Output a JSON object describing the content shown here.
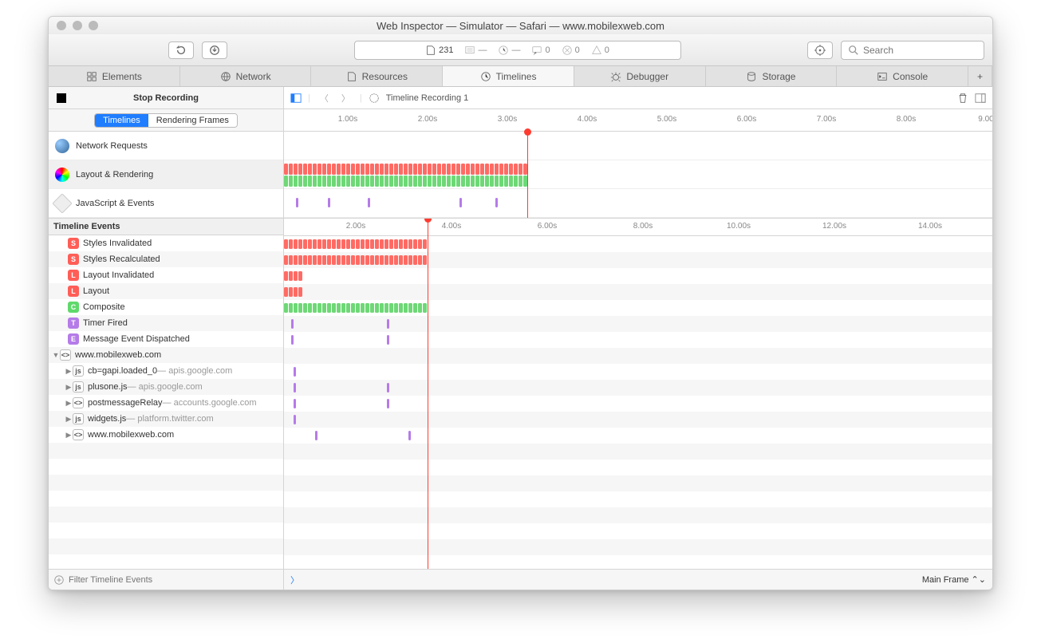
{
  "window_title": "Web Inspector — Simulator — Safari — www.mobilexweb.com",
  "addressbar": {
    "count": "231",
    "msg": "0",
    "err": "0",
    "warn": "0"
  },
  "search": {
    "placeholder": "Search"
  },
  "tabs": [
    "Elements",
    "Network",
    "Resources",
    "Timelines",
    "Debugger",
    "Storage",
    "Console"
  ],
  "active_tab": "Timelines",
  "stop_label": "Stop Recording",
  "segments": {
    "timelines": "Timelines",
    "frames": "Rendering Frames"
  },
  "overview": [
    {
      "label": "Network Requests"
    },
    {
      "label": "Layout & Rendering"
    },
    {
      "label": "JavaScript & Events"
    }
  ],
  "path": {
    "recording": "Timeline Recording 1"
  },
  "ruler_top": [
    "1.00s",
    "2.00s",
    "3.00s",
    "4.00s",
    "5.00s",
    "6.00s",
    "7.00s",
    "8.00s",
    "9.00"
  ],
  "ruler_events": [
    "2.00s",
    "4.00s",
    "6.00s",
    "8.00s",
    "10.00s",
    "12.00s",
    "14.00s"
  ],
  "events_header": "Timeline Events",
  "events": [
    {
      "icon": "S",
      "cls": "b-red",
      "label": "Styles Invalidated"
    },
    {
      "icon": "S",
      "cls": "b-red",
      "label": "Styles Recalculated"
    },
    {
      "icon": "L",
      "cls": "b-red",
      "label": "Layout Invalidated"
    },
    {
      "icon": "L",
      "cls": "b-red",
      "label": "Layout"
    },
    {
      "icon": "C",
      "cls": "b-green",
      "label": "Composite"
    },
    {
      "icon": "T",
      "cls": "b-purple",
      "label": "Timer Fired"
    },
    {
      "icon": "E",
      "cls": "b-purple",
      "label": "Message Event Dispatched"
    },
    {
      "icon": "<>",
      "cls": "b-script",
      "label": "www.mobilexweb.com",
      "expanded": true
    },
    {
      "icon": "js",
      "cls": "b-script",
      "label": "cb=gapi.loaded_0",
      "sub": " — apis.google.com",
      "child": true
    },
    {
      "icon": "js",
      "cls": "b-script",
      "label": "plusone.js",
      "sub": " — apis.google.com",
      "child": true
    },
    {
      "icon": "<>",
      "cls": "b-script",
      "label": "postmessageRelay",
      "sub": " — accounts.google.com",
      "child": true
    },
    {
      "icon": "js",
      "cls": "b-script",
      "label": "widgets.js",
      "sub": " — platform.twitter.com",
      "child": true
    },
    {
      "icon": "<>",
      "cls": "b-script",
      "label": "www.mobilexweb.com",
      "child": true
    }
  ],
  "filter": {
    "placeholder": "Filter Timeline Events"
  },
  "frame_selector": "Main Frame",
  "colors": {
    "red": "#ff6b64",
    "green": "#6ed876",
    "purple": "#b57be8",
    "accent": "#1f7dff",
    "playhead": "#ff3b30"
  }
}
